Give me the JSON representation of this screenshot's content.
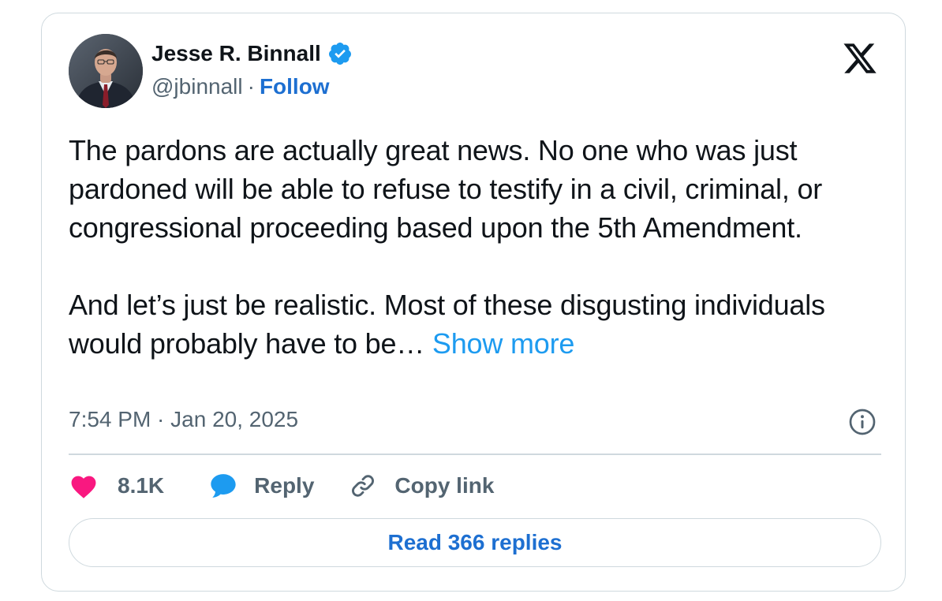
{
  "author": {
    "display_name": "Jesse R. Binnall",
    "handle": "@jbinnall",
    "separator": "·",
    "follow_label": "Follow",
    "verified": true,
    "avatar": "author-avatar-photo"
  },
  "tweet": {
    "paragraph_1": "The pardons are actually great news. No one who was just pardoned will be able to refuse to testify in a civil, criminal, or congressional proceeding based upon the 5th Amendment.",
    "paragraph_2": "And let’s just be realistic. Most of these disgusting individuals would probably have to be…",
    "show_more_label": "Show more",
    "timestamp": "7:54 PM · Jan 20, 2025"
  },
  "actions": {
    "like_count": "8.1K",
    "reply_label": "Reply",
    "copy_link_label": "Copy link"
  },
  "read_replies_label": "Read 366 replies",
  "icons": {
    "brand": "x-logo-icon",
    "verified": "verified-badge-icon",
    "info": "info-icon",
    "like": "heart-icon",
    "reply": "speech-bubble-icon",
    "copy": "link-icon"
  },
  "colors": {
    "link_blue": "#1d6fd1",
    "show_more_blue": "#1d9bf0",
    "heart_pink": "#f91880",
    "reply_blue": "#1d9bf0",
    "secondary_text": "#536471",
    "primary_text": "#0f1419",
    "border": "#cfd9de"
  }
}
